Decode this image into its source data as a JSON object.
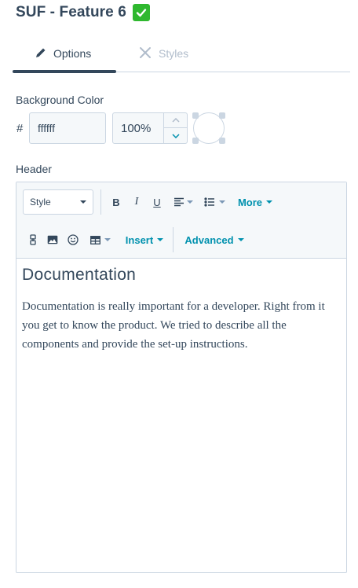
{
  "module": {
    "title": "SUF - Feature 6",
    "status_icon": "check-mark-icon"
  },
  "tabs": [
    {
      "label": "Options",
      "icon": "pencil-icon",
      "active": true
    },
    {
      "label": "Styles",
      "icon": "brush-icon",
      "active": false
    }
  ],
  "background_color": {
    "label": "Background Color",
    "prefix": "#",
    "hex_value": "ffffff",
    "opacity_value": "100%",
    "swatch_color": "#ffffff"
  },
  "header_field": {
    "label": "Header",
    "toolbar": {
      "style_select": "Style",
      "bold": "B",
      "italic": "I",
      "underline": "U",
      "more": "More",
      "insert": "Insert",
      "advanced": "Advanced"
    },
    "content": {
      "heading": "Documentation",
      "paragraph": "Documentation is really important for a developer. Right from it you get to know the product. We tried to describe all the components and provide the set-up instructions."
    }
  },
  "colors": {
    "text": "#33475b",
    "accent": "#0091ae",
    "border": "#cbd6e2",
    "input_bg": "#f5f8fa",
    "check_green": "#2fb82f"
  }
}
